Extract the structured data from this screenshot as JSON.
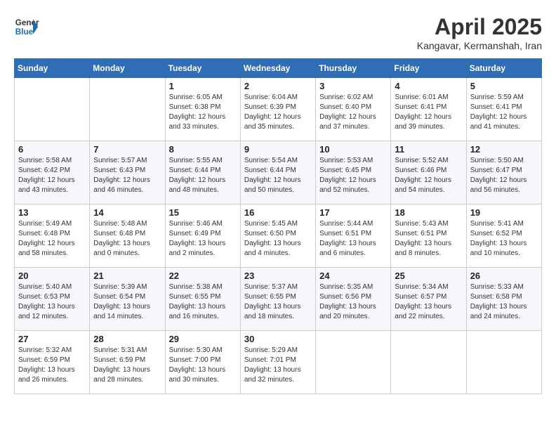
{
  "header": {
    "logo_line1": "General",
    "logo_line2": "Blue",
    "month": "April 2025",
    "location": "Kangavar, Kermanshah, Iran"
  },
  "weekdays": [
    "Sunday",
    "Monday",
    "Tuesday",
    "Wednesday",
    "Thursday",
    "Friday",
    "Saturday"
  ],
  "weeks": [
    [
      {
        "day": "",
        "info": ""
      },
      {
        "day": "",
        "info": ""
      },
      {
        "day": "1",
        "info": "Sunrise: 6:05 AM\nSunset: 6:38 PM\nDaylight: 12 hours\nand 33 minutes."
      },
      {
        "day": "2",
        "info": "Sunrise: 6:04 AM\nSunset: 6:39 PM\nDaylight: 12 hours\nand 35 minutes."
      },
      {
        "day": "3",
        "info": "Sunrise: 6:02 AM\nSunset: 6:40 PM\nDaylight: 12 hours\nand 37 minutes."
      },
      {
        "day": "4",
        "info": "Sunrise: 6:01 AM\nSunset: 6:41 PM\nDaylight: 12 hours\nand 39 minutes."
      },
      {
        "day": "5",
        "info": "Sunrise: 5:59 AM\nSunset: 6:41 PM\nDaylight: 12 hours\nand 41 minutes."
      }
    ],
    [
      {
        "day": "6",
        "info": "Sunrise: 5:58 AM\nSunset: 6:42 PM\nDaylight: 12 hours\nand 43 minutes."
      },
      {
        "day": "7",
        "info": "Sunrise: 5:57 AM\nSunset: 6:43 PM\nDaylight: 12 hours\nand 46 minutes."
      },
      {
        "day": "8",
        "info": "Sunrise: 5:55 AM\nSunset: 6:44 PM\nDaylight: 12 hours\nand 48 minutes."
      },
      {
        "day": "9",
        "info": "Sunrise: 5:54 AM\nSunset: 6:44 PM\nDaylight: 12 hours\nand 50 minutes."
      },
      {
        "day": "10",
        "info": "Sunrise: 5:53 AM\nSunset: 6:45 PM\nDaylight: 12 hours\nand 52 minutes."
      },
      {
        "day": "11",
        "info": "Sunrise: 5:52 AM\nSunset: 6:46 PM\nDaylight: 12 hours\nand 54 minutes."
      },
      {
        "day": "12",
        "info": "Sunrise: 5:50 AM\nSunset: 6:47 PM\nDaylight: 12 hours\nand 56 minutes."
      }
    ],
    [
      {
        "day": "13",
        "info": "Sunrise: 5:49 AM\nSunset: 6:48 PM\nDaylight: 12 hours\nand 58 minutes."
      },
      {
        "day": "14",
        "info": "Sunrise: 5:48 AM\nSunset: 6:48 PM\nDaylight: 13 hours\nand 0 minutes."
      },
      {
        "day": "15",
        "info": "Sunrise: 5:46 AM\nSunset: 6:49 PM\nDaylight: 13 hours\nand 2 minutes."
      },
      {
        "day": "16",
        "info": "Sunrise: 5:45 AM\nSunset: 6:50 PM\nDaylight: 13 hours\nand 4 minutes."
      },
      {
        "day": "17",
        "info": "Sunrise: 5:44 AM\nSunset: 6:51 PM\nDaylight: 13 hours\nand 6 minutes."
      },
      {
        "day": "18",
        "info": "Sunrise: 5:43 AM\nSunset: 6:51 PM\nDaylight: 13 hours\nand 8 minutes."
      },
      {
        "day": "19",
        "info": "Sunrise: 5:41 AM\nSunset: 6:52 PM\nDaylight: 13 hours\nand 10 minutes."
      }
    ],
    [
      {
        "day": "20",
        "info": "Sunrise: 5:40 AM\nSunset: 6:53 PM\nDaylight: 13 hours\nand 12 minutes."
      },
      {
        "day": "21",
        "info": "Sunrise: 5:39 AM\nSunset: 6:54 PM\nDaylight: 13 hours\nand 14 minutes."
      },
      {
        "day": "22",
        "info": "Sunrise: 5:38 AM\nSunset: 6:55 PM\nDaylight: 13 hours\nand 16 minutes."
      },
      {
        "day": "23",
        "info": "Sunrise: 5:37 AM\nSunset: 6:55 PM\nDaylight: 13 hours\nand 18 minutes."
      },
      {
        "day": "24",
        "info": "Sunrise: 5:35 AM\nSunset: 6:56 PM\nDaylight: 13 hours\nand 20 minutes."
      },
      {
        "day": "25",
        "info": "Sunrise: 5:34 AM\nSunset: 6:57 PM\nDaylight: 13 hours\nand 22 minutes."
      },
      {
        "day": "26",
        "info": "Sunrise: 5:33 AM\nSunset: 6:58 PM\nDaylight: 13 hours\nand 24 minutes."
      }
    ],
    [
      {
        "day": "27",
        "info": "Sunrise: 5:32 AM\nSunset: 6:59 PM\nDaylight: 13 hours\nand 26 minutes."
      },
      {
        "day": "28",
        "info": "Sunrise: 5:31 AM\nSunset: 6:59 PM\nDaylight: 13 hours\nand 28 minutes."
      },
      {
        "day": "29",
        "info": "Sunrise: 5:30 AM\nSunset: 7:00 PM\nDaylight: 13 hours\nand 30 minutes."
      },
      {
        "day": "30",
        "info": "Sunrise: 5:29 AM\nSunset: 7:01 PM\nDaylight: 13 hours\nand 32 minutes."
      },
      {
        "day": "",
        "info": ""
      },
      {
        "day": "",
        "info": ""
      },
      {
        "day": "",
        "info": ""
      }
    ]
  ]
}
